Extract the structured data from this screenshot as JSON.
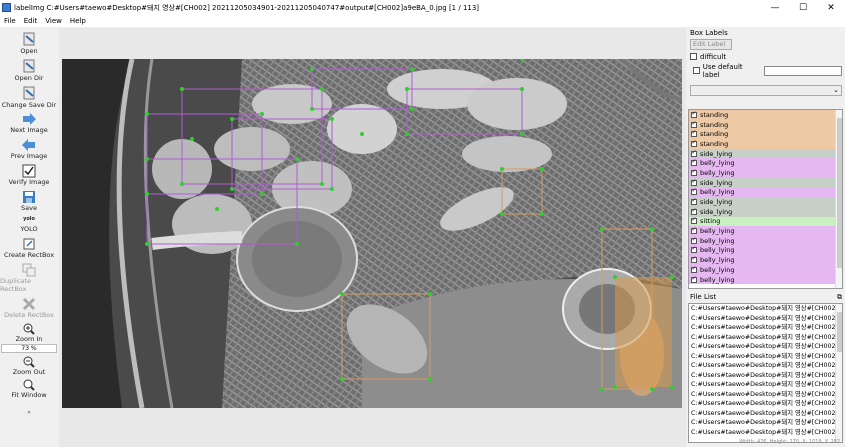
{
  "window": {
    "title": "labelImg C:#Users#taewo#Desktop#돼지 영상#[CH002] 20211205034901-20211205040747#output#[CH002]a9eBA_0.jpg [1 / 113]",
    "minimize": "—",
    "maximize": "☐",
    "close": "✕"
  },
  "menu": [
    "File",
    "Edit",
    "View",
    "Help"
  ],
  "toolbar": {
    "open": "Open",
    "open_dir": "Open Dir",
    "change_save_dir": "Change Save Dir",
    "next_image": "Next Image",
    "prev_image": "Prev Image",
    "verify_image": "Verify Image",
    "save": "Save",
    "format_icon_text": "yolo",
    "format": "YOLO",
    "create_rectbox": "Create RectBox",
    "duplicate_rectbox": "Duplicate RectBox",
    "delete_rectbox": "Delete RectBox",
    "zoom_in": "Zoom In",
    "zoom_value": "73 %",
    "zoom_out": "Zoom Out",
    "fit_window": "Fit Window"
  },
  "box_labels": {
    "title": "Box Labels",
    "edit_label": "Edit Label",
    "difficult": "difficult",
    "use_default_label": "Use default label",
    "default_label_value": "",
    "items": [
      {
        "label": "standing",
        "color": "#eec9a6"
      },
      {
        "label": "standing",
        "color": "#eec9a6"
      },
      {
        "label": "standing",
        "color": "#eec9a6"
      },
      {
        "label": "standing",
        "color": "#eec9a6"
      },
      {
        "label": "side_lying",
        "color": "#c6d0c6"
      },
      {
        "label": "belly_lying",
        "color": "#e6b8f2"
      },
      {
        "label": "belly_lying",
        "color": "#e6b8f2"
      },
      {
        "label": "side_lying",
        "color": "#c6d0c6"
      },
      {
        "label": "belly_lying",
        "color": "#e6b8f2"
      },
      {
        "label": "side_lying",
        "color": "#c6d0c6"
      },
      {
        "label": "side_lying",
        "color": "#c6d0c6"
      },
      {
        "label": "sitting",
        "color": "#c8f0c0"
      },
      {
        "label": "belly_lying",
        "color": "#e6b8f2"
      },
      {
        "label": "belly_lying",
        "color": "#e6b8f2"
      },
      {
        "label": "belly_lying",
        "color": "#e6b8f2"
      },
      {
        "label": "belly_lying",
        "color": "#e6b8f2"
      },
      {
        "label": "belly_lying",
        "color": "#e6b8f2"
      },
      {
        "label": "belly_lying",
        "color": "#e6b8f2"
      }
    ]
  },
  "file_list": {
    "title": "File List",
    "float_icon": "⧉",
    "items": [
      "C:#Users#taewo#Desktop#돼지 영상#[CH002]",
      "C:#Users#taewo#Desktop#돼지 영상#[CH002]",
      "C:#Users#taewo#Desktop#돼지 영상#[CH002]",
      "C:#Users#taewo#Desktop#돼지 영상#[CH002]",
      "C:#Users#taewo#Desktop#돼지 영상#[CH002]",
      "C:#Users#taewo#Desktop#돼지 영상#[CH002]",
      "C:#Users#taewo#Desktop#돼지 영상#[CH002]",
      "C:#Users#taewo#Desktop#돼지 영상#[CH002]",
      "C:#Users#taewo#Desktop#돼지 영상#[CH002]",
      "C:#Users#taewo#Desktop#돼지 영상#[CH002]",
      "C:#Users#taewo#Desktop#돼지 영상#[CH002]",
      "C:#Users#taewo#Desktop#돼지 영상#[CH002]",
      "C:#Users#taewo#Desktop#돼지 영상#[CH002]",
      "C:#Users#taewo#Desktop#돼지 영상#[CH002]"
    ]
  },
  "status": "Width: 476, Height: 270, X: 1019, Y: 282"
}
